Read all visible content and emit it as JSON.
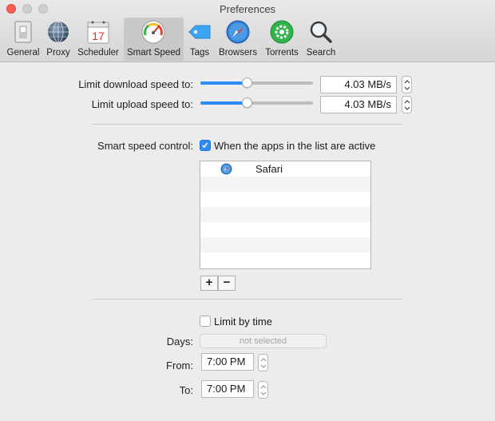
{
  "window": {
    "title": "Preferences"
  },
  "toolbar": {
    "items": [
      {
        "label": "General",
        "icon": "switch-icon"
      },
      {
        "label": "Proxy",
        "icon": "globe-icon"
      },
      {
        "label": "Scheduler",
        "icon": "calendar-icon",
        "calendar_day": "17"
      },
      {
        "label": "Smart Speed",
        "icon": "speedometer-icon",
        "active": true
      },
      {
        "label": "Tags",
        "icon": "tag-icon"
      },
      {
        "label": "Browsers",
        "icon": "compass-icon"
      },
      {
        "label": "Torrents",
        "icon": "torrent-gear-icon"
      },
      {
        "label": "Search",
        "icon": "magnifier-icon"
      }
    ]
  },
  "speed": {
    "download_label": "Limit download speed to:",
    "download_value": "4.03 MB/s",
    "download_slider_fraction": 0.41,
    "upload_label": "Limit upload speed to:",
    "upload_value": "4.03 MB/s",
    "upload_slider_fraction": 0.41
  },
  "smart": {
    "label": "Smart speed control:",
    "checkbox_checked": true,
    "checkbox_text": "When the apps in the list are active",
    "apps": [
      {
        "name": "Safari",
        "icon": "safari-icon"
      }
    ],
    "add_label": "+",
    "remove_label": "−"
  },
  "time": {
    "limit_checked": false,
    "limit_label": "Limit by time",
    "days_label": "Days:",
    "days_value": "not selected",
    "from_label": "From:",
    "from_value": "7:00 PM",
    "to_label": "To:",
    "to_value": "7:00 PM"
  },
  "colors": {
    "accent": "#2c8bf5",
    "close": "#fc5f57",
    "torrents_green": "#2fb34a",
    "tag_blue": "#3aa5f0"
  }
}
